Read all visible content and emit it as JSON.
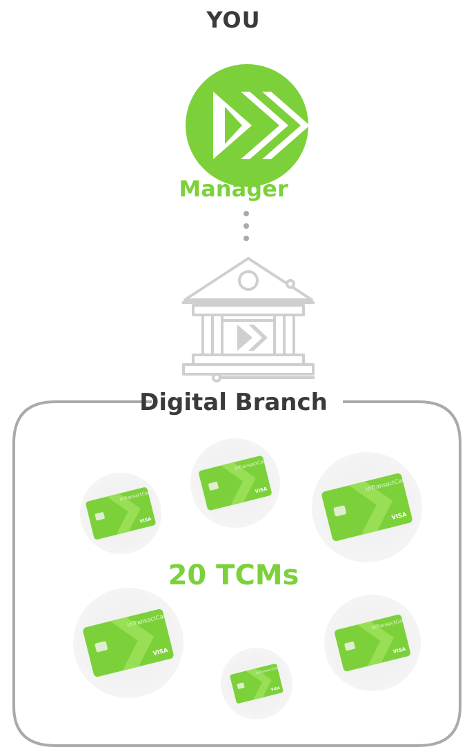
{
  "header": {
    "title": "YOU"
  },
  "manager": {
    "label": "Manager"
  },
  "branch": {
    "label": "Digital Branch"
  },
  "members": {
    "label": "20 TCMs"
  },
  "card": {
    "brand_text": "inTransactCard",
    "network_text": "VISA"
  },
  "icons": {
    "logo": "double-chevron-logo-icon",
    "connector": "dotted-connector-icon",
    "bank": "bank-building-icon",
    "card": "credit-card-icon"
  },
  "colors": {
    "brand": "#7cd13b",
    "text": "#3a3a3a",
    "line": "#aaaaaa"
  }
}
